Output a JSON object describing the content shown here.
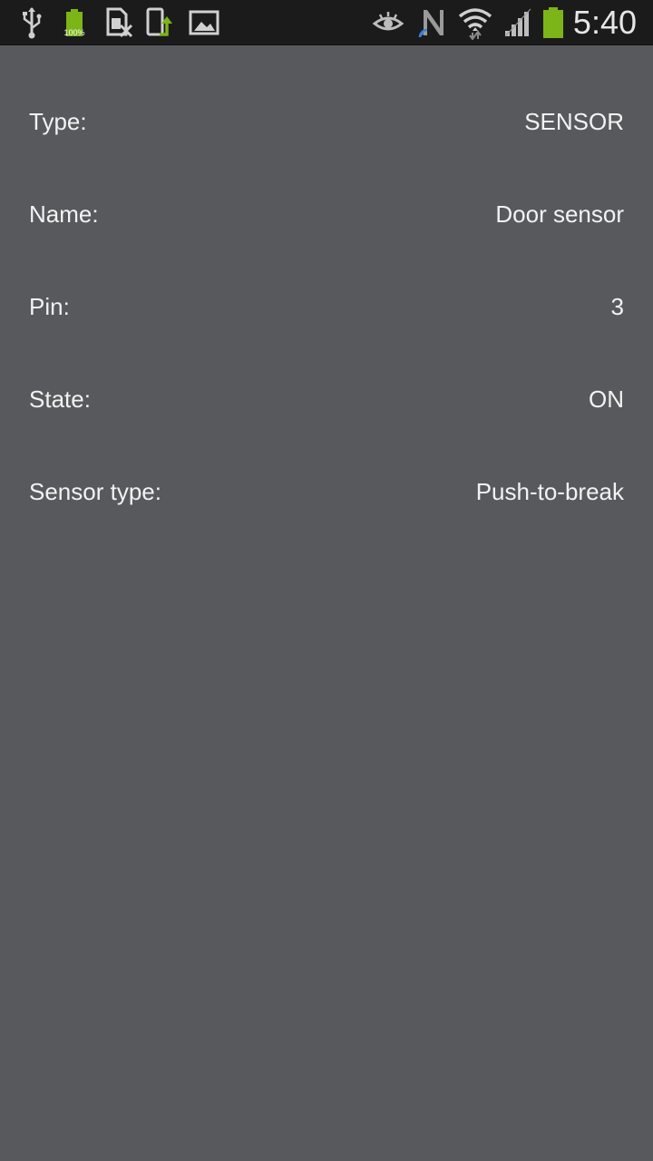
{
  "status_bar": {
    "time": "5:40",
    "battery_small_label": "100%",
    "accent_color": "#7cb518",
    "left_icons": [
      "usb-icon",
      "battery-full-icon",
      "sim-card-x-icon",
      "screenshot-upload-icon",
      "image-icon"
    ],
    "right_icons": [
      "eye-icon",
      "nfc-icon",
      "wifi-icon",
      "signal-icon",
      "battery-icon"
    ]
  },
  "details": [
    {
      "label": "Type:",
      "value": "SENSOR"
    },
    {
      "label": "Name:",
      "value": "Door sensor"
    },
    {
      "label": "Pin:",
      "value": "3"
    },
    {
      "label": "State:",
      "value": "ON"
    },
    {
      "label": "Sensor type:",
      "value": "Push-to-break"
    }
  ]
}
